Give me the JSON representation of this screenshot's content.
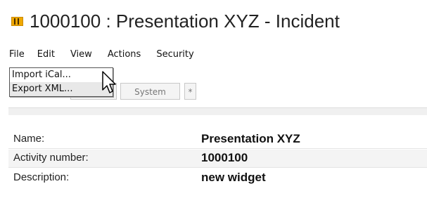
{
  "title": {
    "text": "1000100 : Presentation XYZ - Incident",
    "icon": "incident-flag-icon",
    "icon_color": "#f0a800"
  },
  "menu": {
    "items": [
      "File",
      "Edit",
      "View",
      "Actions",
      "Security"
    ]
  },
  "file_menu": {
    "items": [
      "Import iCal...",
      "Export XML..."
    ]
  },
  "toolbar": {
    "system_label": "System",
    "star_label": "*"
  },
  "details": {
    "rows": [
      {
        "label": "Name:",
        "value": "Presentation XYZ"
      },
      {
        "label": "Activity number:",
        "value": "1000100"
      },
      {
        "label": "Description:",
        "value": "new widget"
      }
    ]
  }
}
